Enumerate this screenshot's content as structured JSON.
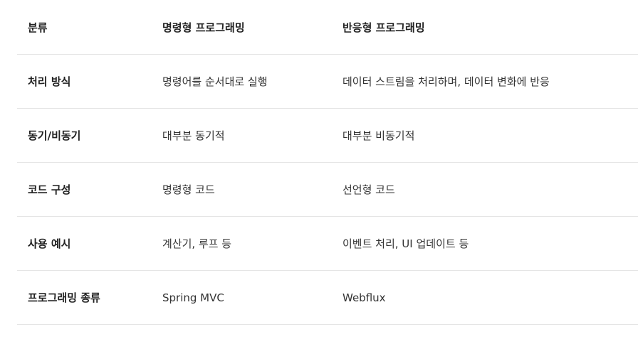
{
  "table": {
    "headers": [
      "분류",
      "명령형 프로그래밍",
      "반응형 프로그래밍"
    ],
    "rows": [
      [
        "처리 방식",
        "명령어를 순서대로 실행",
        "데이터 스트림을 처리하며, 데이터 변화에 반응"
      ],
      [
        "동기/비동기",
        "대부분 동기적",
        "대부분 비동기적"
      ],
      [
        "코드 구성",
        "명령형 코드",
        "선언형 코드"
      ],
      [
        "사용 예시",
        "계산기, 루프 등",
        "이벤트 처리, UI 업데이트 등"
      ],
      [
        "프로그래밍 종류",
        "Spring MVC",
        "Webflux"
      ]
    ]
  }
}
